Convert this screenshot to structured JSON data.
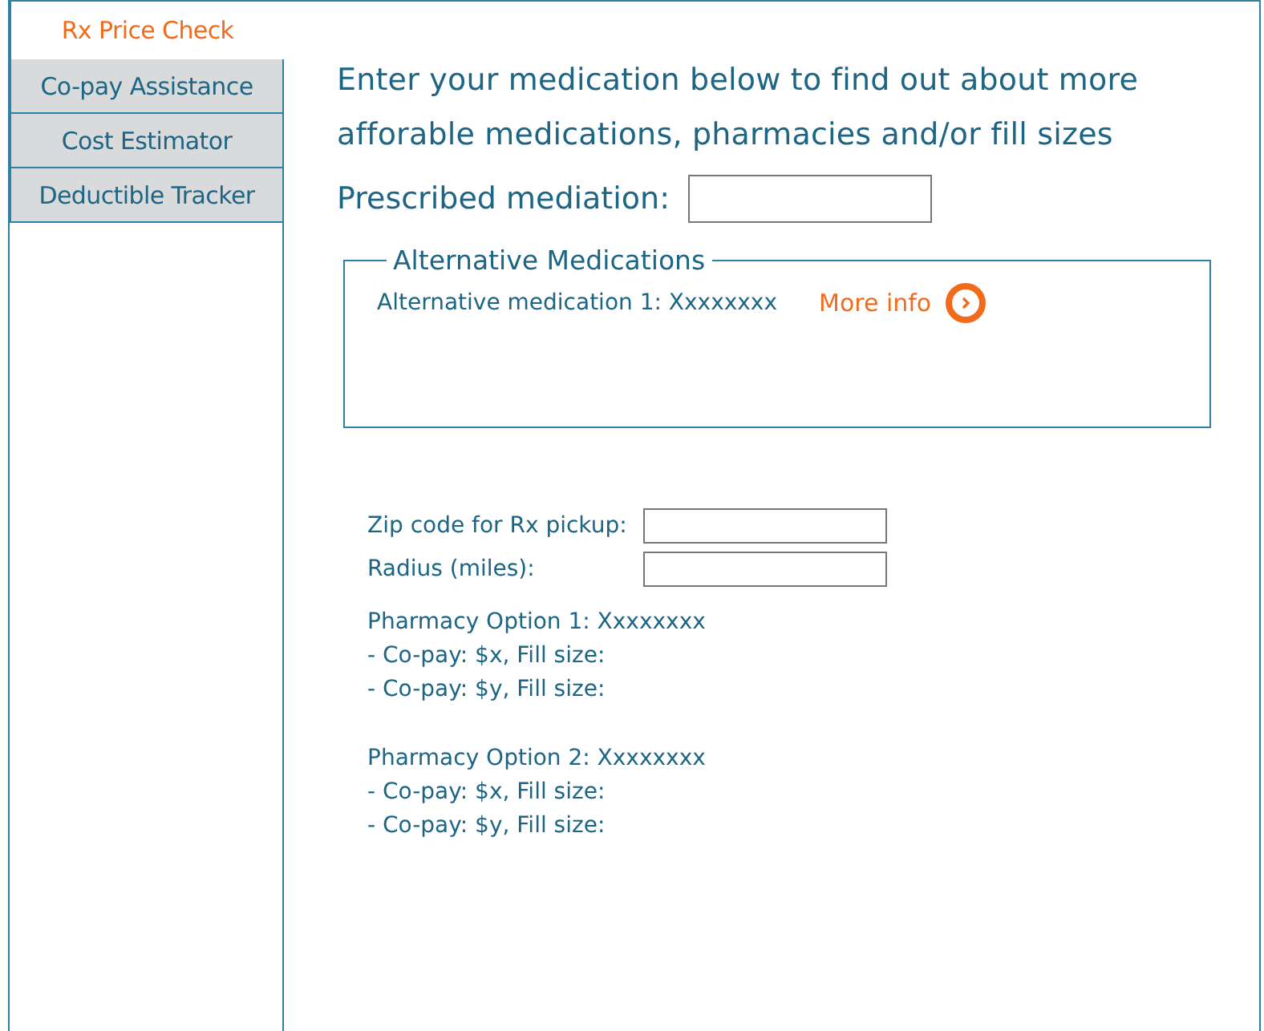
{
  "tabs": [
    {
      "label": "Rx Price Check",
      "selected": true
    },
    {
      "label": "Co-pay Assistance",
      "selected": false
    },
    {
      "label": "Cost Estimator",
      "selected": false
    },
    {
      "label": "Deductible Tracker",
      "selected": false
    }
  ],
  "intro": "Enter your medication below to find out about more afforable medications, pharmacies and/or fill sizes",
  "prescribed_field": {
    "label": "Prescribed mediation:"
  },
  "alternatives": {
    "title": "Alternative Medications",
    "items": [
      {
        "text": "Alternative medication 1: Xxxxxxxx",
        "link": "More info"
      }
    ]
  },
  "location_fields": [
    {
      "label": "Zip code for Rx pickup:"
    },
    {
      "label": "Radius (miles):"
    }
  ],
  "pharmacies": [
    {
      "title": "Pharmacy Option 1: Xxxxxxxx",
      "lines": [
        "- Co-pay: $x, Fill size:",
        "- Co-pay: $y, Fill size:"
      ]
    },
    {
      "title": "Pharmacy Option 2: Xxxxxxxx",
      "lines": [
        "- Co-pay: $x, Fill size:",
        "- Co-pay: $y, Fill size:"
      ]
    }
  ]
}
